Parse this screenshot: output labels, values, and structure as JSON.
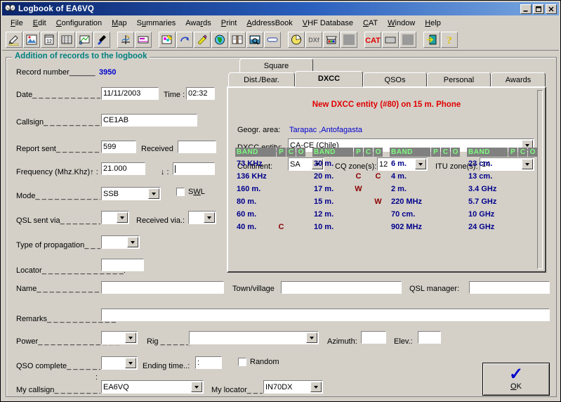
{
  "window": {
    "title": "Logbook of EA6VQ",
    "icon": "butterfly-icon",
    "minimize_label": "_",
    "maximize_label": "□",
    "close_label": "✕"
  },
  "menubar": {
    "items": [
      {
        "label": "File",
        "accel": "F"
      },
      {
        "label": "Edit",
        "accel": "E"
      },
      {
        "label": "Configuration",
        "accel": "C"
      },
      {
        "label": "Map",
        "accel": "M"
      },
      {
        "label": "Summaries",
        "accel": "u"
      },
      {
        "label": "Awards",
        "accel": "r"
      },
      {
        "label": "Print",
        "accel": "P"
      },
      {
        "label": "AddressBook",
        "accel": "A"
      },
      {
        "label": "VHF Database",
        "accel": "V"
      },
      {
        "label": "CAT",
        "accel": "C"
      },
      {
        "label": "Window",
        "accel": "W"
      },
      {
        "label": "Help",
        "accel": "H"
      }
    ]
  },
  "toolbar": {
    "buttons": [
      {
        "name": "new-record-icon"
      },
      {
        "name": "open-logbook-icon"
      },
      {
        "name": "calendar-icon"
      },
      {
        "name": "table-grid-icon"
      },
      {
        "name": "chart-icon"
      },
      {
        "name": "flag-icon"
      },
      {
        "name": "separator"
      },
      {
        "name": "axes-icon"
      },
      {
        "name": "label-icon"
      },
      {
        "name": "separator"
      },
      {
        "name": "palette-icon"
      },
      {
        "name": "redo-arrow-icon"
      },
      {
        "name": "pencil-icon"
      },
      {
        "name": "globe-icon"
      },
      {
        "name": "book-icon"
      },
      {
        "name": "search-box-icon"
      },
      {
        "name": "pill-icon"
      },
      {
        "name": "separator"
      },
      {
        "name": "clock-pie-icon"
      },
      {
        "name": "dxf-icon"
      },
      {
        "name": "printer-color-icon"
      },
      {
        "name": "blank-icon"
      },
      {
        "name": "separator"
      },
      {
        "name": "cat-icon",
        "label": "CAT"
      },
      {
        "name": "keyboard-icon"
      },
      {
        "name": "blank2-icon"
      },
      {
        "name": "separator"
      },
      {
        "name": "exit-door-icon"
      },
      {
        "name": "help-question-icon"
      }
    ]
  },
  "group": {
    "title": "Addition of records to the logbook"
  },
  "form": {
    "record_number_label": "Record number",
    "record_number_dots": "______",
    "record_number_value": "3950",
    "date_label": "Date",
    "date_dots": "_ _ _ _ _ _ _ _ _ _ _ _ _ _",
    "date_value": "11/11/2003",
    "time_label": "Time :",
    "time_value": "02:32",
    "callsign_label": "Callsign",
    "callsign_dots": "_ _ _ _ _ _ _ _ _ _ _ _",
    "callsign_value": "CE1AB",
    "report_sent_label": "Report sent",
    "report_sent_dots": "_ _ _ _ _ _ _ _ _",
    "report_sent_value": "599",
    "received_label": "Received",
    "received_value": "",
    "frequency_label": "Frequency (Mhz.Khz)↑ :",
    "frequency_value": "21.000",
    "frequency_down_label": "↓ :",
    "frequency_down_value": "",
    "mode_label": "Mode",
    "mode_dots": "_ _ _ _ _ _ _ _ _ _ _ _ _",
    "mode_value": "SSB",
    "swl_label": "SWL",
    "swl_checked": false,
    "qsl_sent_label": "QSL sent via",
    "qsl_sent_dots": "_ _ _ _ _ _ _ _ _",
    "qsl_sent_value": "",
    "received_via_label": "Received via.:",
    "received_via_value": "",
    "propagation_label": "Type of propagation",
    "propagation_dots": "_ _ _ :",
    "propagation_value": "",
    "locator_label": "Locator",
    "locator_dots": "_ _ _ _ _ _ _ _ _ _ _ _ _",
    "locator_value": "",
    "name_label": "Name",
    "name_dots": "_ _ _ _ _ _ _ _ _ _ _ _ _ _",
    "name_value": "",
    "town_label": "Town/village",
    "town_value": "",
    "qsl_manager_label": "QSL manager:",
    "qsl_manager_value": "",
    "remarks_label": "Remarks",
    "remarks_dots": "_ _ _ _ _ _ _ _ _ _ _",
    "remarks_value": "",
    "power_label": "Power",
    "power_dots": "_ _ _ _ _ _ _ _ _ _ _ _ _",
    "power_value": "",
    "rig_label": "Rig",
    "rig_dots": "_ _ _ _ _",
    "rig_value": "",
    "azimuth_label": "Azimuth:",
    "azimuth_value": "",
    "elev_label": "Elev.:",
    "elev_value": "",
    "qso_complete_label": "QSO complete",
    "qso_complete_dots": "_ _ _ _ _ _ _",
    "qso_complete_value": "",
    "ending_time_label": "Ending time..:",
    "ending_time_value": ":",
    "random_label": "Random",
    "random_checked": false,
    "my_callsign_label": "My callsign",
    "my_callsign_dots": "_ _ _ _ _ _ _ _ _ _",
    "my_callsign_value": "EA6VQ",
    "my_locator_label": "My locator",
    "my_locator_dots": "_ _ _",
    "my_locator_value": "IN70DX",
    "stray_colon": ":"
  },
  "tabs": {
    "square": {
      "label": "Square"
    },
    "items": [
      {
        "label": "Dist./Bear.",
        "active": false
      },
      {
        "label": "DXCC",
        "active": true
      },
      {
        "label": "QSOs",
        "active": false
      },
      {
        "label": "Personal",
        "active": false
      },
      {
        "label": "Awards",
        "active": false
      }
    ]
  },
  "dxcc": {
    "message": "New DXCC entity (#80) on 15 m. Phone",
    "message_color": "#e00000",
    "geogr_area_label": "Geogr. area:",
    "geogr_area_value": "Tarapac ,Antofagasta",
    "entity_label": "DXCC entity:",
    "entity_value": "CA-CE (Chile)",
    "continent_label": "Continent:",
    "continent_value": "SA",
    "cq_zone_label": "CQ zone(s):",
    "cq_zone_value": "12",
    "itu_zone_label": "ITU zone(s):",
    "itu_zone_value": "14",
    "band_table": {
      "header": {
        "band": "BAND",
        "p": "P",
        "c": "C",
        "o": "O"
      },
      "header_bg": "#808080",
      "header_fg": "#7cfc7c",
      "band_fg": "#00008b",
      "mark_fg": "#8b0000",
      "columns": [
        {
          "rows": [
            {
              "band": "73 KHz",
              "p": "",
              "c": "",
              "o": ""
            },
            {
              "band": "136 KHz",
              "p": "",
              "c": "",
              "o": ""
            },
            {
              "band": "160 m.",
              "p": "",
              "c": "",
              "o": ""
            },
            {
              "band": "80 m.",
              "p": "",
              "c": "",
              "o": ""
            },
            {
              "band": "60 m.",
              "p": "",
              "c": "",
              "o": ""
            },
            {
              "band": "40 m.",
              "p": "C",
              "c": "",
              "o": ""
            }
          ]
        },
        {
          "rows": [
            {
              "band": "30 m.",
              "p": "",
              "c": "",
              "o": ""
            },
            {
              "band": "20 m.",
              "p": "C",
              "c": "",
              "o": "C"
            },
            {
              "band": "17 m.",
              "p": "W",
              "c": "",
              "o": ""
            },
            {
              "band": "15 m.",
              "p": "",
              "c": "",
              "o": "W"
            },
            {
              "band": "12 m.",
              "p": "",
              "c": "",
              "o": ""
            },
            {
              "band": "10 m.",
              "p": "",
              "c": "",
              "o": ""
            }
          ]
        },
        {
          "rows": [
            {
              "band": "6 m.",
              "p": "",
              "c": "",
              "o": ""
            },
            {
              "band": "4 m.",
              "p": "",
              "c": "",
              "o": ""
            },
            {
              "band": "2 m.",
              "p": "",
              "c": "",
              "o": ""
            },
            {
              "band": "220 MHz",
              "p": "",
              "c": "",
              "o": ""
            },
            {
              "band": "70 cm.",
              "p": "",
              "c": "",
              "o": ""
            },
            {
              "band": "902 MHz",
              "p": "",
              "c": "",
              "o": ""
            }
          ]
        },
        {
          "rows": [
            {
              "band": "23 cm.",
              "p": "",
              "c": "",
              "o": ""
            },
            {
              "band": "13 cm.",
              "p": "",
              "c": "",
              "o": ""
            },
            {
              "band": "3.4 GHz",
              "p": "",
              "c": "",
              "o": ""
            },
            {
              "band": "5.7 GHz",
              "p": "",
              "c": "",
              "o": ""
            },
            {
              "band": "10 GHz",
              "p": "",
              "c": "",
              "o": ""
            },
            {
              "band": "24 GHz",
              "p": "",
              "c": "",
              "o": ""
            }
          ]
        }
      ]
    }
  },
  "ok_button": {
    "glyph": "✓",
    "label_prefix": "",
    "label_accel": "O",
    "label_rest": "K"
  }
}
